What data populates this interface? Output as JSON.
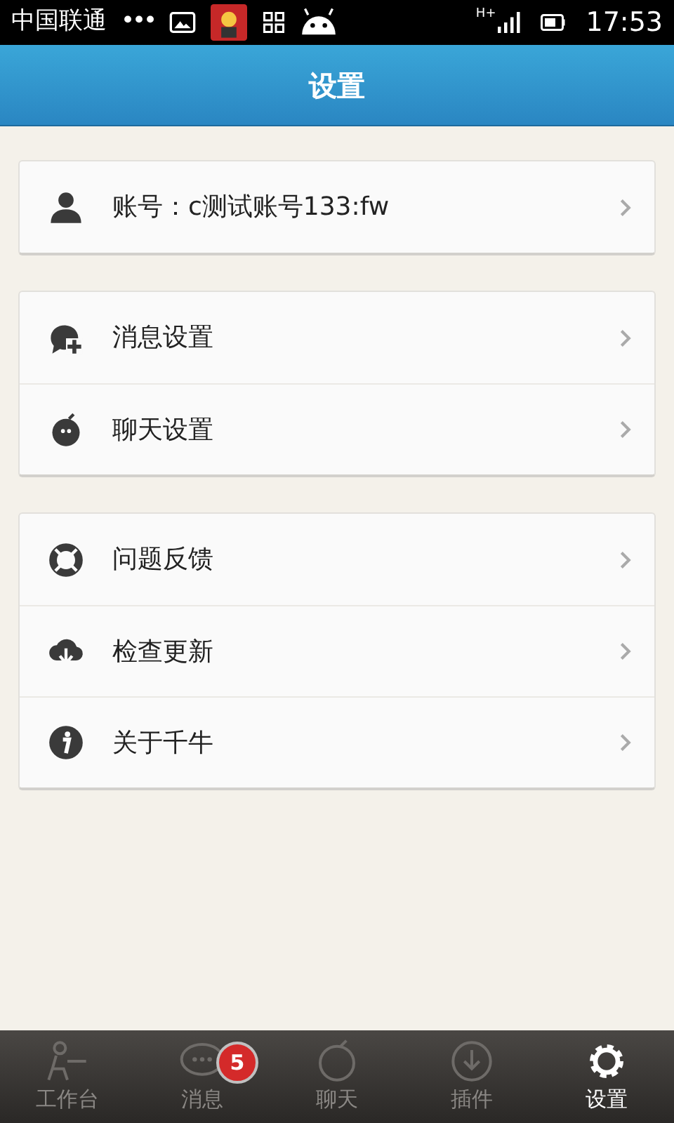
{
  "status_bar": {
    "carrier": "中国联通",
    "dots": "•••",
    "network": "H+",
    "time": "17:53"
  },
  "header": {
    "title": "设置"
  },
  "groups": [
    {
      "items": [
        {
          "kind": "account",
          "label": "账号：c测试账号133:fw"
        }
      ]
    },
    {
      "items": [
        {
          "kind": "message",
          "label": "消息设置"
        },
        {
          "kind": "chat",
          "label": "聊天设置"
        }
      ]
    },
    {
      "items": [
        {
          "kind": "feedback",
          "label": "问题反馈"
        },
        {
          "kind": "update",
          "label": "检查更新"
        },
        {
          "kind": "about",
          "label": "关于千牛"
        }
      ]
    }
  ],
  "tab_bar": [
    {
      "kind": "workbench",
      "label": "工作台",
      "selected": false
    },
    {
      "kind": "messages",
      "label": "消息",
      "selected": false,
      "badge": "5"
    },
    {
      "kind": "chat",
      "label": "聊天",
      "selected": false
    },
    {
      "kind": "plugins",
      "label": "插件",
      "selected": false
    },
    {
      "kind": "settings",
      "label": "设置",
      "selected": true
    }
  ]
}
